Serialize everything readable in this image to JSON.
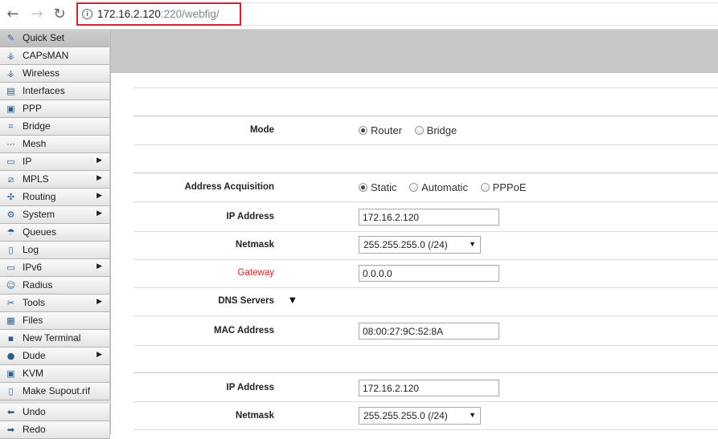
{
  "browser": {
    "url_host": "172.16.2.120",
    "url_rest": ":220/webfig/"
  },
  "sidebar": {
    "items": [
      {
        "label": "Quick Set",
        "icon": "quickset-icon",
        "glyph": "✎",
        "submenu": false,
        "active": true
      },
      {
        "label": "CAPsMAN",
        "icon": "capsman-icon",
        "glyph": "⚶",
        "submenu": false
      },
      {
        "label": "Wireless",
        "icon": "wireless-icon",
        "glyph": "⚶",
        "submenu": false
      },
      {
        "label": "Interfaces",
        "icon": "interfaces-icon",
        "glyph": "▤",
        "submenu": false
      },
      {
        "label": "PPP",
        "icon": "ppp-icon",
        "glyph": "▣",
        "submenu": false
      },
      {
        "label": "Bridge",
        "icon": "bridge-icon",
        "glyph": "⌗",
        "submenu": false
      },
      {
        "label": "Mesh",
        "icon": "mesh-icon",
        "glyph": "⋯",
        "submenu": false
      },
      {
        "label": "IP",
        "icon": "ip-icon",
        "glyph": "▭",
        "submenu": true
      },
      {
        "label": "MPLS",
        "icon": "mpls-icon",
        "glyph": "⧄",
        "submenu": true
      },
      {
        "label": "Routing",
        "icon": "routing-icon",
        "glyph": "✣",
        "submenu": true
      },
      {
        "label": "System",
        "icon": "system-icon",
        "glyph": "⚙",
        "submenu": true
      },
      {
        "label": "Queues",
        "icon": "queues-icon",
        "glyph": "☂",
        "submenu": false
      },
      {
        "label": "Log",
        "icon": "log-icon",
        "glyph": "▯",
        "submenu": false
      },
      {
        "label": "IPv6",
        "icon": "ipv6-icon",
        "glyph": "▭",
        "submenu": true
      },
      {
        "label": "Radius",
        "icon": "radius-icon",
        "glyph": "☺",
        "submenu": false
      },
      {
        "label": "Tools",
        "icon": "tools-icon",
        "glyph": "✂",
        "submenu": true
      },
      {
        "label": "Files",
        "icon": "files-icon",
        "glyph": "▦",
        "submenu": false
      },
      {
        "label": "New Terminal",
        "icon": "terminal-icon",
        "glyph": "▪",
        "submenu": false
      },
      {
        "label": "Dude",
        "icon": "dude-icon",
        "glyph": "●",
        "submenu": true
      },
      {
        "label": "KVM",
        "icon": "kvm-icon",
        "glyph": "▣",
        "submenu": false
      },
      {
        "label": "Make Supout.rif",
        "icon": "supout-icon",
        "glyph": "▯",
        "submenu": false
      },
      {
        "label": "Undo",
        "icon": "undo-icon",
        "glyph": "⬅",
        "submenu": false
      },
      {
        "label": "Redo",
        "icon": "redo-icon",
        "glyph": "➡",
        "submenu": false
      }
    ]
  },
  "form": {
    "mode": {
      "label": "Mode",
      "options": [
        "Router",
        "Bridge"
      ],
      "selected": "Router"
    },
    "address_acquisition": {
      "label": "Address Acquisition",
      "options": [
        "Static",
        "Automatic",
        "PPPoE"
      ],
      "selected": "Static"
    },
    "ip_address": {
      "label": "IP Address",
      "value": "172.16.2.120"
    },
    "netmask": {
      "label": "Netmask",
      "value": "255.255.255.0 (/24)"
    },
    "gateway": {
      "label": "Gateway",
      "value": "0.0.0.0"
    },
    "dns": {
      "label": "DNS Servers"
    },
    "mac_address": {
      "label": "MAC Address",
      "value": "08:00:27:9C:52:8A"
    },
    "local_ip_address": {
      "label": "IP Address",
      "value": "172.16.2.120"
    },
    "local_netmask": {
      "label": "Netmask",
      "value": "255.255.255.0 (/24)"
    }
  },
  "colors": {
    "highlight_box": "#d0232f",
    "gateway_label": "#c82020",
    "header_gray": "#c8c8c8"
  }
}
